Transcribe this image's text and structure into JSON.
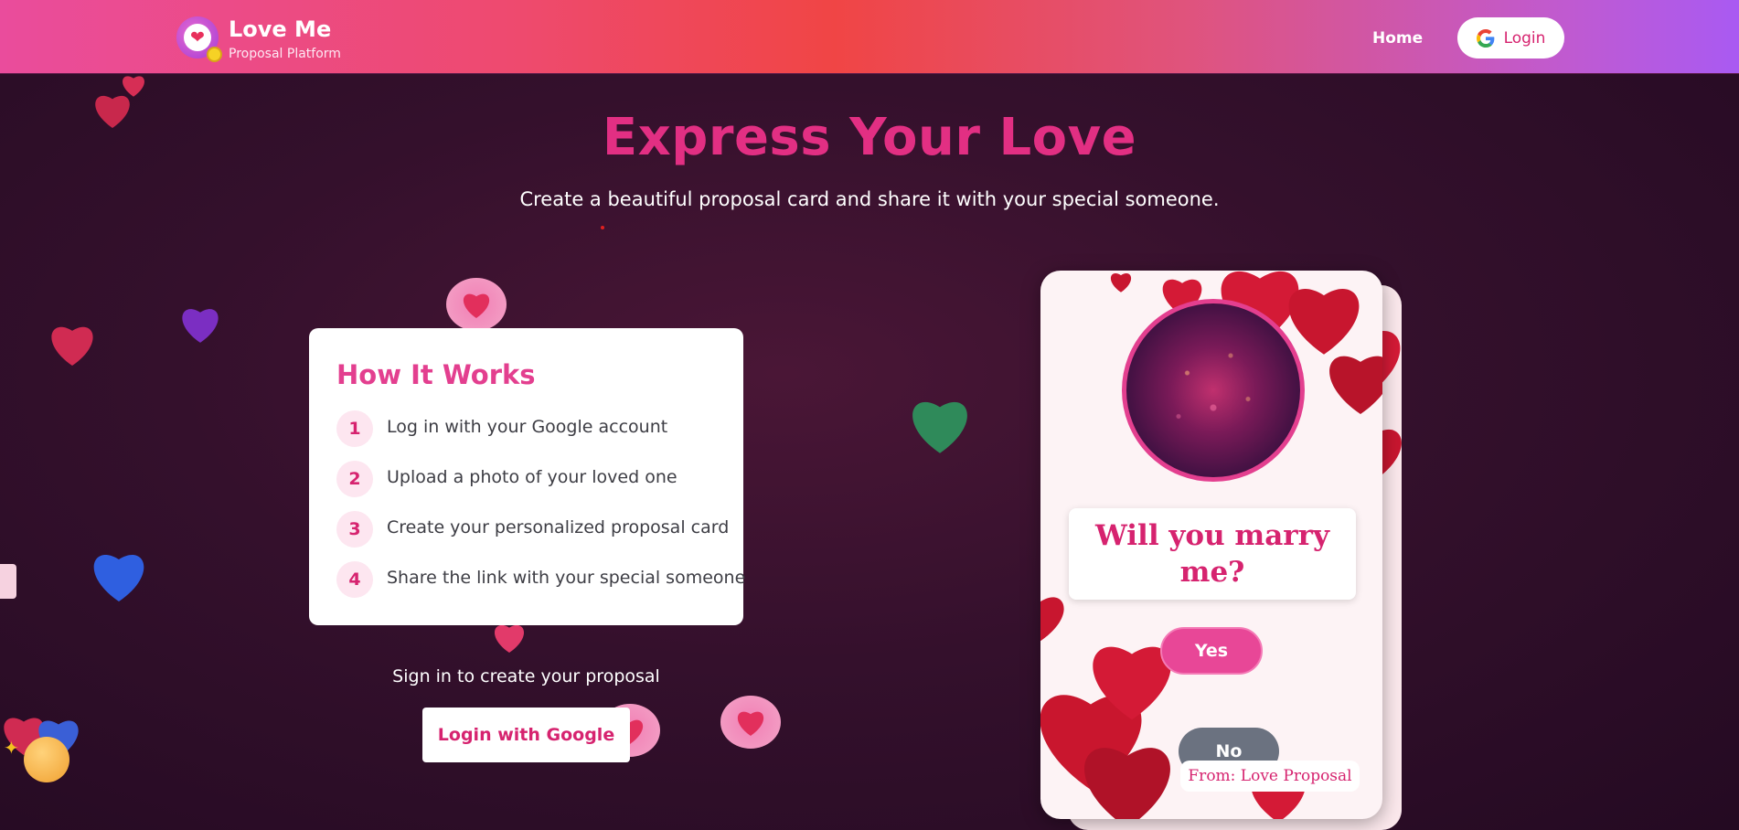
{
  "header": {
    "brand_title": "Love Me",
    "brand_subtitle": "Proposal Platform",
    "nav_home": "Home",
    "login_label": "Login"
  },
  "hero": {
    "title": "Express Your Love",
    "subtitle": "Create a beautiful proposal card and share it with your special someone."
  },
  "how_it_works": {
    "title": "How It Works",
    "steps": [
      {
        "num": "1",
        "text": "Log in with your Google account"
      },
      {
        "num": "2",
        "text": "Upload a photo of your loved one"
      },
      {
        "num": "3",
        "text": "Create your personalized proposal card"
      },
      {
        "num": "4",
        "text": "Share the link with your special someone"
      }
    ]
  },
  "signin": {
    "prompt": "Sign in to create your proposal",
    "button_label": "Login with Google"
  },
  "proposal_card": {
    "question": "Will you marry me?",
    "yes_label": "Yes",
    "no_label": "No",
    "from_label": "From: Love Proposal"
  },
  "colors": {
    "accent_pink": "#e22f83",
    "header_start": "#ea4c9c",
    "header_mid": "#f04545",
    "header_end": "#a95af2",
    "background": "#34102c"
  },
  "icons": {
    "logo": "heart-icon",
    "login": "google-icon",
    "decorations": "floating-heart-icon"
  }
}
